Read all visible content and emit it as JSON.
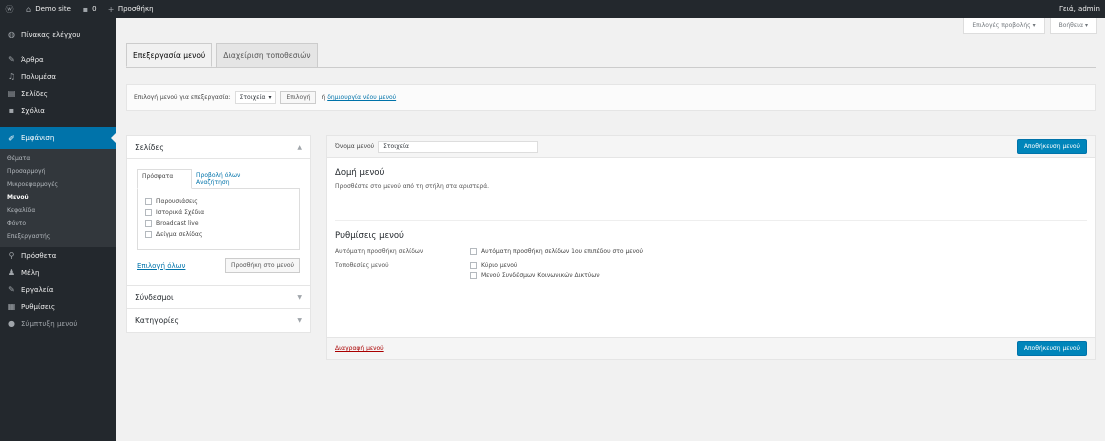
{
  "adminbar": {
    "site_name": "Demo site",
    "new_label": "Προσθήκη",
    "user_greeting": "Γειά, admin"
  },
  "screen_meta": {
    "options_label": "Επιλογές προβολής ▾",
    "help_label": "Βοήθεια ▾"
  },
  "sidebar": {
    "items_top": [
      {
        "label": "Πίνακας ελέγχου",
        "icon": "dashboard-icon"
      },
      {
        "label": "Άρθρα",
        "icon": "pin-icon"
      },
      {
        "label": "Πολυμέσα",
        "icon": "media-icon"
      },
      {
        "label": "Σελίδες",
        "icon": "page-icon"
      },
      {
        "label": "Σχόλια",
        "icon": "comment-icon"
      }
    ],
    "current": {
      "label": "Εμφάνιση",
      "icon": "brush-icon"
    },
    "submenu": [
      "Θέματα",
      "Προσαρμογή",
      "Μικροεφαρμογές",
      "Μενού",
      "Κεφαλίδα",
      "Φόντο",
      "Επεξεργαστής"
    ],
    "items_bottom": [
      {
        "label": "Πρόσθετα",
        "icon": "plugin-icon"
      },
      {
        "label": "Μέλη",
        "icon": "users-icon"
      },
      {
        "label": "Εργαλεία",
        "icon": "tools-icon"
      },
      {
        "label": "Ρυθμίσεις",
        "icon": "settings-icon"
      }
    ],
    "collapse_label": "Σύμπτυξη μενού"
  },
  "tabs": {
    "edit": "Επεξεργασία μενού",
    "locations": "Διαχείριση τοποθεσιών"
  },
  "manage": {
    "select_label": "Επιλογή μενού για επεξεργασία:",
    "selected_menu": "Στοιχεία",
    "select_button": "Επιλογή",
    "or_text": "ή",
    "create_link": "δημιουργία νέου μενού"
  },
  "accordion": {
    "pages_title": "Σελίδες",
    "subtab_recent": "Πρόσφατα",
    "subtab_all": "Προβολή όλων",
    "subtab_search": "Αναζήτηση",
    "pages": [
      "Παρουσιάσεις",
      "Ιστορικά Σχέδια",
      "Broadcast live",
      "Δείγμα σελίδας"
    ],
    "select_all": "Επιλογή όλων",
    "add_button": "Προσθήκη στο μενού",
    "links_title": "Σύνδεσμοι",
    "categories_title": "Κατηγορίες"
  },
  "menu_edit": {
    "name_label": "Όνομα μενού",
    "name_value": "Στοιχεία",
    "save_button": "Αποθήκευση μενού",
    "structure_title": "Δομή μενού",
    "structure_desc": "Προσθέστε στο μενού από τη στήλη στα αριστερά.",
    "settings_title": "Ρυθμίσεις μενού",
    "auto_add_label": "Αυτόματη προσθήκη σελίδων",
    "auto_add_option": "Αυτόματη προσθήκη σελίδων 1ου επιπέδου στο μενού",
    "location_label": "Τοποθεσίες μενού",
    "locations": [
      "Κύριο μενού",
      "Μενού Συνδέσμων Κοινωνικών Δικτύων"
    ],
    "delete_link": "Διαγραφή μενού"
  }
}
